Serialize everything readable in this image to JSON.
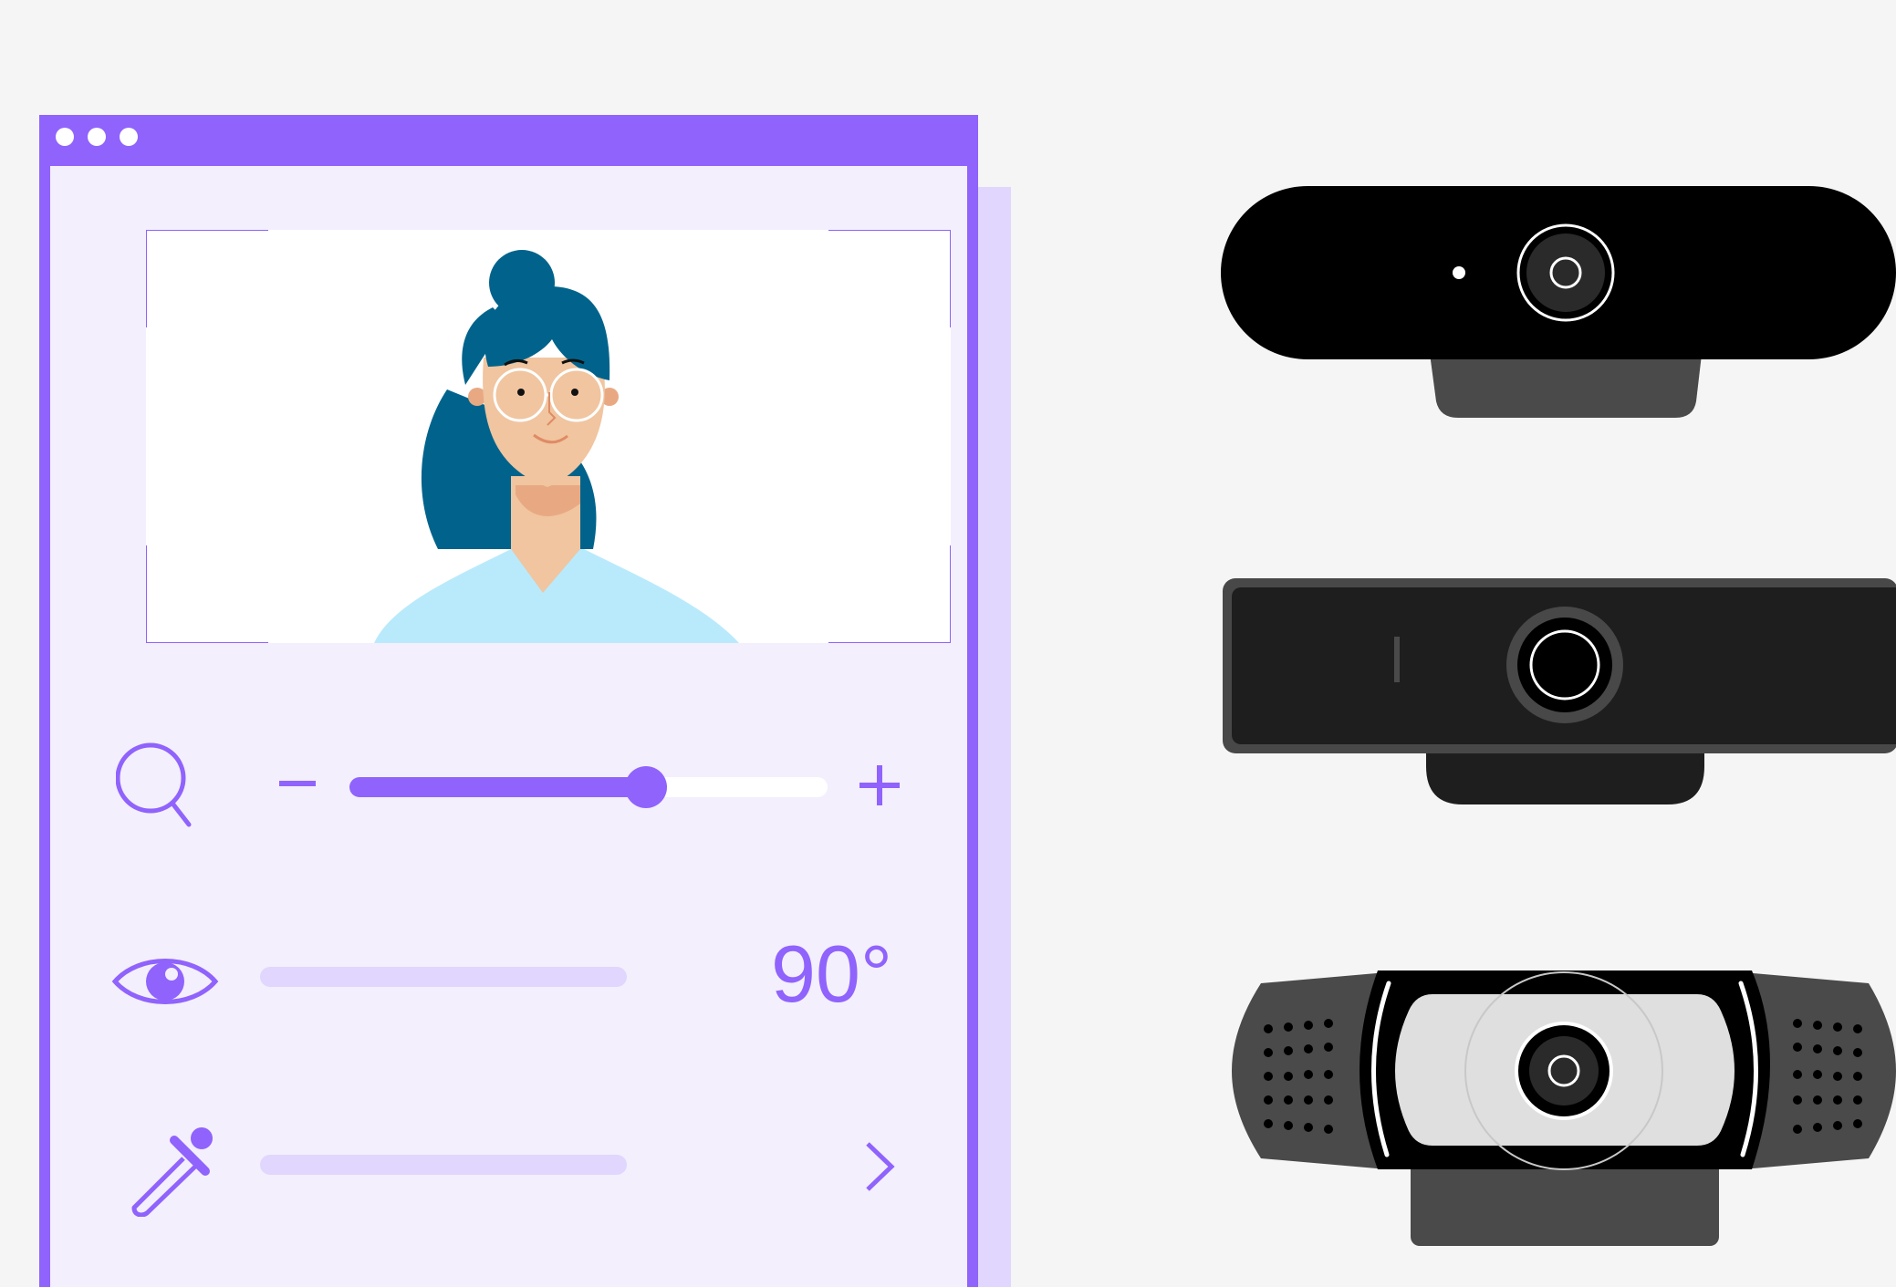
{
  "window": {
    "titlebar_dots": 3,
    "accent_color": "#8f63fc",
    "panel_color": "#f3effd",
    "track_color": "#e1d6fd"
  },
  "controls": {
    "zoom": {
      "icon": "search-icon",
      "minus_label": "−",
      "plus_label": "+",
      "level": 0.62
    },
    "field_of_view": {
      "icon": "eye-icon",
      "value": "90°"
    },
    "color_picker": {
      "icon": "eyedropper-icon",
      "next_icon": "chevron-right-icon"
    }
  },
  "devices": [
    {
      "name": "webcam-1",
      "icon": "webcam-bar-icon"
    },
    {
      "name": "webcam-2",
      "icon": "webcam-box-icon"
    },
    {
      "name": "webcam-3",
      "icon": "webcam-speaker-icon"
    }
  ]
}
